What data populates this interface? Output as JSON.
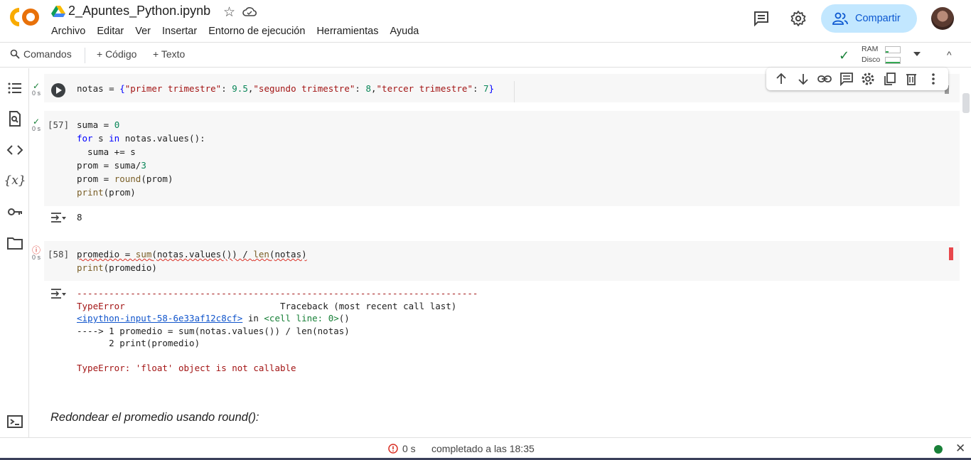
{
  "app": {
    "title": "2_Apuntes_Python.ipynb",
    "menu": [
      "Archivo",
      "Editar",
      "Ver",
      "Insertar",
      "Entorno de ejecución",
      "Herramientas",
      "Ayuda"
    ],
    "share_label": "Compartir",
    "accent": "#c2e7ff",
    "brand_orange": "#f9ab00"
  },
  "toolbar": {
    "commands_label": "Comandos",
    "code_label": "+ Código",
    "text_label": "+ Texto",
    "ram_label": "RAM",
    "disk_label": "Disco"
  },
  "rail": {
    "icons": [
      "toc-icon",
      "find-icon",
      "code-snippets-icon",
      "variables-icon",
      "secrets-key-icon",
      "files-folder-icon",
      "terminal-icon"
    ]
  },
  "cells": [
    {
      "status_time": "0 s",
      "status": "ok",
      "exec_count": "",
      "code_lines": [
        "notas = {\"primer trimestre\": 9.5,\"segundo trimestre\": 8,\"tercer trimestre\": 7}"
      ]
    },
    {
      "status_time": "0 s",
      "status": "ok",
      "exec_count": "[57]",
      "code_lines": [
        "suma = 0",
        "for s in notas.values():",
        "  suma += s",
        "prom = suma/3",
        "prom = round(prom)",
        "print(prom)"
      ],
      "output": "8"
    },
    {
      "status_time": "0 s",
      "status": "error",
      "exec_count": "[58]",
      "code_lines": [
        "promedio = sum(notas.values()) / len(notas)",
        "print(promedio)"
      ],
      "traceback": {
        "dash_line": "---------------------------------------------------------------------------",
        "error_name": "TypeError",
        "traceback_header": "Traceback (most recent call last)",
        "input_ref": "<ipython-input-58-6e33af12c8cf>",
        "in_word": " in ",
        "cell_line": "<cell line: 0>",
        "cell_line_suffix": "()",
        "arrow_line": "----> 1 promedio = sum(notas.values()) / len(notas)",
        "line2": "      2 print(promedio)",
        "error_message": "TypeError: 'float' object is not callable"
      }
    }
  ],
  "markdown": {
    "heading": "Redondear el promedio usando round():"
  },
  "statusbar": {
    "time": "0 s",
    "completed_text": "completado a las 18:35"
  }
}
